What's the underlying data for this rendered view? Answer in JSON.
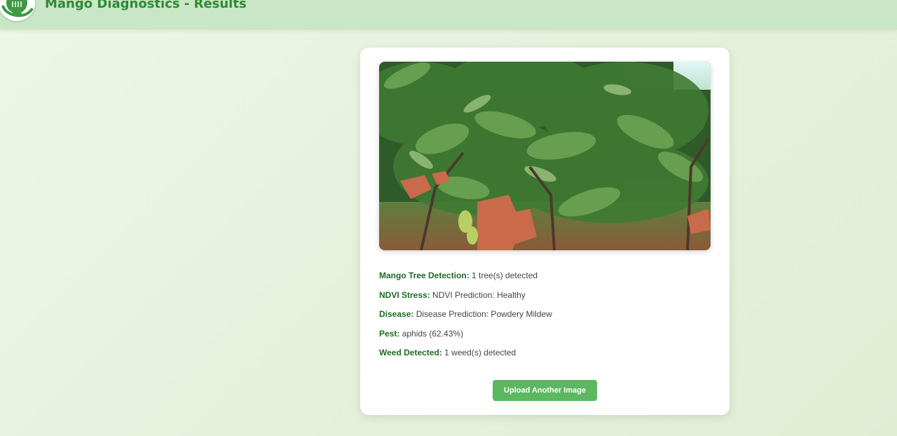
{
  "header": {
    "title": "Mango Diagnostics - Results",
    "logo_icon": "leaf-logo-icon"
  },
  "image": {
    "description_icon": "mango-tree-photo"
  },
  "results": [
    {
      "label": "Mango Tree Detection:",
      "value": "1 tree(s) detected"
    },
    {
      "label": "NDVI Stress:",
      "value": "NDVI Prediction: Healthy"
    },
    {
      "label": "Disease:",
      "value": "Disease Prediction: Powdery Mildew"
    },
    {
      "label": "Pest:",
      "value": "aphids (62.43%)"
    },
    {
      "label": "Weed Detected:",
      "value": "1 weed(s) detected"
    }
  ],
  "actions": {
    "upload_label": "Upload Another Image"
  },
  "colors": {
    "header_bg": "#c9e6c6",
    "title_green": "#2f8a34",
    "label_green": "#1f6b25",
    "button_green": "#5cb860"
  }
}
